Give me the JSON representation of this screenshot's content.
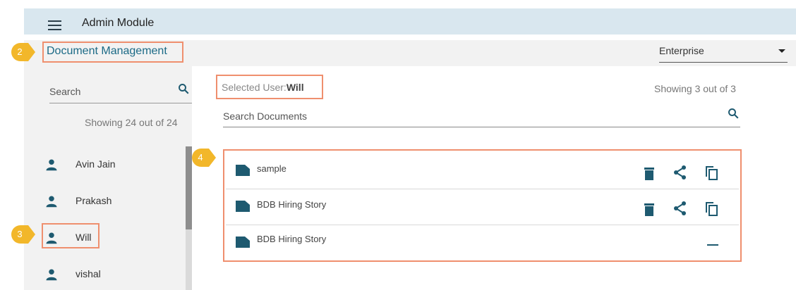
{
  "header": {
    "title": "Admin Module",
    "menu_icon": "hamburger-menu-icon"
  },
  "subheader": {
    "title": "Document Management",
    "enterprise_select": {
      "value": "Enterprise"
    }
  },
  "callouts": [
    "2",
    "3",
    "4"
  ],
  "users_panel": {
    "search_placeholder": "Search",
    "showing": "Showing 24 out of 24",
    "users": [
      "Avin Jain",
      "Prakash",
      "Will",
      "vishal"
    ]
  },
  "documents_panel": {
    "selected_user_label": "Selected User:",
    "selected_user_name": "Will",
    "showing": "Showing 3 out of 3",
    "search_placeholder": "Search Documents",
    "documents": [
      {
        "name": "sample",
        "actions": [
          "delete-icon",
          "share-icon",
          "copy-icon"
        ]
      },
      {
        "name": "BDB Hiring Story",
        "actions": [
          "delete-icon",
          "share-icon",
          "copy-icon"
        ]
      },
      {
        "name": "BDB Hiring Story",
        "actions": [
          "remove-icon"
        ]
      }
    ]
  },
  "colors": {
    "accent": "#1b6a86",
    "icon": "#1e5a70",
    "callout": "#f2b72a",
    "highlight": "#ef8f6e",
    "topbar": "#d9e7ef"
  }
}
